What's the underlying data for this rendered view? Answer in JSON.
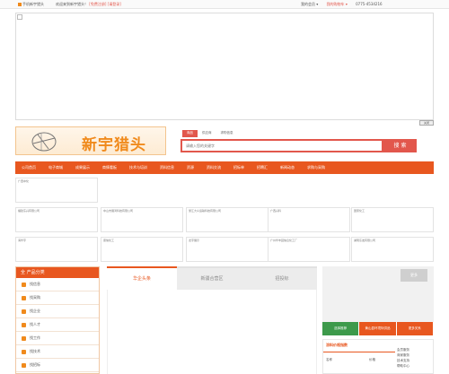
{
  "topbar": {
    "home": "手机新宇猎头",
    "welcome": "欢迎来到新宇猎头！",
    "welcome_link": "[免费注册] [请登录]",
    "member": "我的会员 ▾",
    "cart": "我的购物车 ▾",
    "phone": "0775-4534216"
  },
  "banner": {
    "close_label": "关闭"
  },
  "logo": {
    "name": "新宇猎头"
  },
  "search": {
    "tabs": [
      "商品",
      "供应商",
      "求购信息"
    ],
    "placeholder": "请输入您的关键字",
    "button": "搜 索"
  },
  "nav": [
    "公司首页",
    "电子商城",
    "成果展示",
    "商情看板",
    "技术与培训",
    "资料信息",
    "资源",
    "资料交流",
    "招标单",
    "招聘汇",
    "新闻动态",
    "求购与采购"
  ],
  "companies": [
    "广西中化",
    "福建东兴有限公司",
    "中山市展鸿科技有限公司",
    "浙江大众运输科技有限公司",
    "广西兴科",
    "国家化工",
    "海华宇",
    "康信化工",
    "龙宇展示",
    "广州华丰园信息化工厂",
    "湖南东发有限公司"
  ],
  "sidebar": {
    "title": "全 产品分类",
    "items": [
      "找信息",
      "找采购",
      "找企业",
      "找人才",
      "找工作",
      "找技术",
      "找招标"
    ]
  },
  "middle_tabs": [
    "华企头条",
    "新疆合营区",
    "招投标"
  ],
  "right": {
    "more": "更多",
    "tabs": [
      "选择推荐",
      "黄山县环境特供品",
      "更多关系"
    ],
    "price_title": "涂料价格指数",
    "price_cols": [
      "名称",
      "价格"
    ],
    "links": [
      "会员服务",
      "商家服务",
      "技术支持",
      "帮助中心"
    ]
  },
  "colors": {
    "accent": "#e8571f",
    "brand": "#f08a1c",
    "search_red": "#e2574c",
    "tab_green": "#3d9a4b"
  }
}
